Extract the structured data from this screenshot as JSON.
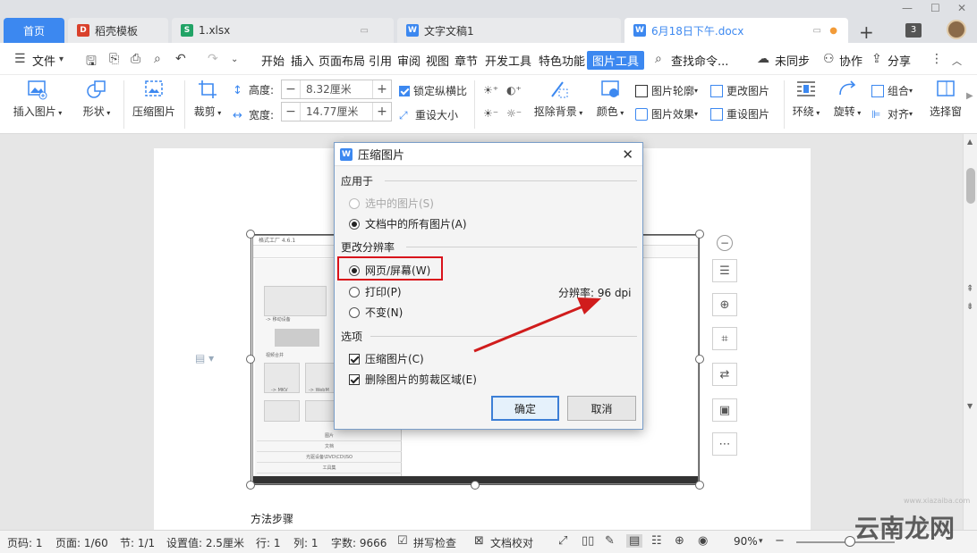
{
  "tabs": {
    "home": "首页",
    "items": [
      {
        "label": "稻壳模板",
        "color": "#d9412c",
        "glyph": "D"
      },
      {
        "label": "1.xlsx",
        "color": "#21a366",
        "glyph": "S"
      },
      {
        "label": "文字文稿1",
        "color": "#3c88f0",
        "glyph": "W"
      },
      {
        "label": "6月18日下午.docx",
        "color": "#3c88f0",
        "glyph": "W"
      }
    ],
    "window_count": "3"
  },
  "menu": {
    "file": "文件",
    "items": [
      "开始",
      "插入",
      "页面布局",
      "引用",
      "审阅",
      "视图",
      "章节",
      "开发工具",
      "特色功能"
    ],
    "active": "图片工具",
    "search": "查找命令...",
    "sync": "未同步",
    "collab": "协作",
    "share": "分享"
  },
  "ribbon": {
    "insert_image": "插入图片",
    "shape": "形状",
    "compress": "压缩图片",
    "crop": "裁剪",
    "height_label": "高度:",
    "height_value": "8.32厘米",
    "width_label": "宽度:",
    "width_value": "14.77厘米",
    "lock_ratio": "锁定纵横比",
    "reset_size": "重设大小",
    "remove_bg": "抠除背景",
    "color": "颜色",
    "outline": "图片轮廓",
    "effect": "图片效果",
    "change_image": "更改图片",
    "reset_image": "重设图片",
    "wrap": "环绕",
    "rotate": "旋转",
    "group": "组合",
    "align": "对齐",
    "select_pane": "选择窗"
  },
  "dialog": {
    "title": "压缩图片",
    "apply_to": "应用于",
    "opt_selected": "选中的图片(S)",
    "opt_all": "文档中的所有图片(A)",
    "change_res": "更改分辨率",
    "opt_web": "网页/屏幕(W)",
    "opt_print": "打印(P)",
    "opt_nochange": "不变(N)",
    "resolution": "分辨率:  96 dpi",
    "options": "选项",
    "cb_compress": "压缩图片(C)",
    "cb_delete_crop": "删除图片的剪裁区域(E)",
    "ok": "确定",
    "cancel": "取消"
  },
  "document": {
    "steps": "方法步骤",
    "shot_title": "格式工厂 4.6.1",
    "shot_rows": [
      "图片",
      "文档",
      "光驱设备\\DVD\\CD\\ISO",
      "工具集"
    ],
    "shot_labels": [
      "-> 移动设备",
      "视频合并",
      "-> MKV",
      "-> WebM"
    ]
  },
  "status": {
    "page_num": "页码: 1",
    "page": "页面: 1/60",
    "section": "节: 1/1",
    "setting": "设置值: 2.5厘米",
    "row": "行: 1",
    "col": "列: 1",
    "words": "字数: 9666",
    "spell": "拼写检查",
    "proof": "文档校对",
    "zoom": "90%"
  },
  "watermark": "云南龙网",
  "watermark_url": "www.xiazaiba.com",
  "colors": {
    "accent": "#3c88f0",
    "highlight_red": "#d9121b",
    "arrow_red": "#d01c1c"
  }
}
